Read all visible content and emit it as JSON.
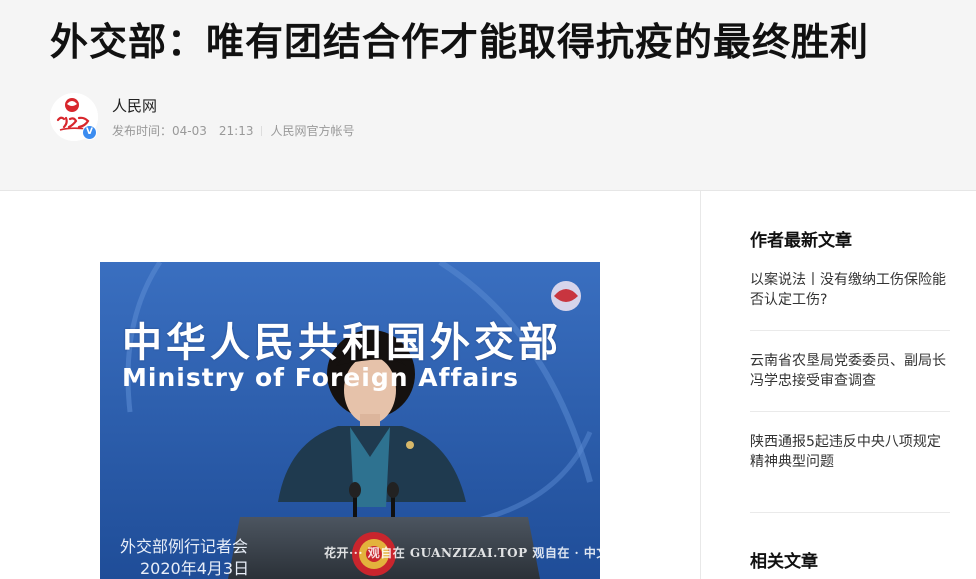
{
  "article": {
    "title": "外交部：唯有团结合作才能取得抗疫的最终胜利"
  },
  "author": {
    "name": "人民网",
    "avatar_text": "人民网",
    "verified_mark": "V",
    "publish_label": "发布时间：",
    "publish_date": "04-03",
    "publish_time": "21:13",
    "account_note": "人民网官方帐号"
  },
  "photo": {
    "backdrop_cn": "中华人民共和国外交部",
    "backdrop_en": "Ministry of Foreign Affairs",
    "caption_line1": "外交部例行记者会",
    "caption_line2": "2020年4月3日",
    "watermark": "花开··· 观自在  GUANZIZAI.TOP  观自在 · 中文良品"
  },
  "sidebar": {
    "latest_heading": "作者最新文章",
    "latest_items": [
      {
        "title": "以案说法丨没有缴纳工伤保险能否认定工伤?"
      },
      {
        "title": "云南省农垦局党委委员、副局长冯学忠接受审查调查"
      },
      {
        "title": "陕西通报5起违反中央八项规定精神典型问题"
      }
    ],
    "related_heading": "相关文章"
  },
  "colors": {
    "header_bg": "#f5f5f5",
    "verified_blue": "#3b8cf0",
    "backdrop_blue": "#2b5fae"
  }
}
